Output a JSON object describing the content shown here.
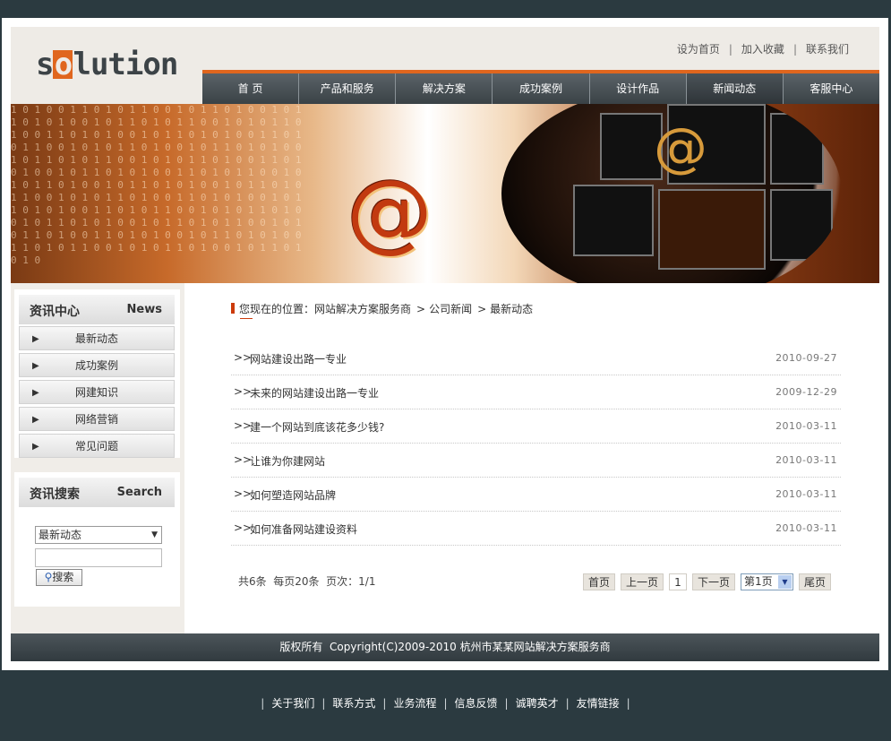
{
  "header": {
    "logo_text": "solution",
    "top_links": [
      "设为首页",
      "加入收藏",
      "联系我们"
    ],
    "nav": [
      "首 页",
      "产品和服务",
      "解决方案",
      "成功案例",
      "设计作品",
      "新闻动态",
      "客服中心"
    ],
    "active_nav": "新闻动态"
  },
  "banner": {
    "binary": "1 0 1 0 0 1 1 0 1 0 1 1 0 0 1 0 1 1 0 1 0 0 1 0 1 1 0 1 0 1 0 0 1 0 1 1 0 1 0 1 1 0 0 1 0 1 0 1 1 0 1 0 0 1 1 0 1 0 1 0 0 1 0 1 1 0 1 0 1 0 0 1 1 0 1 0 1 1 0 0 1 0 1 0 1 1 0 1 0 0 1 0 1 1 0 1 0 1 0 0 1 0 1 1 0 1 0 1 1 0 0 1 0 1 0 1 1 0 1 0 0 1 1 0 1 0 1 0 0 1 0 1 1 0 1 0 1 0 0 1 1 0 1 0 1 1 0 0 1 0 1 0 1 1 0 1 0 0 1 0 1 1 0 1 0 1 0 0 1 0 1 1 0 1 0 1 1 0 0 1 0 1 0 1 1 0 1 0 0 1 1 0 1 0 1 0 0 1 0 1 1 0 1 0 1 0 0 1 1 0 1 0 1 1 0 0 1 0 1 0 1 1 0 1 0 0 1 0 1 1 0 1 0 1 0 0 1 0 1 1 0 1 0 1 1 0 0 1 0 1 0 1 1 0 1 0 0 1 1 0 1 0 1 0 0 1 0 1 1 0 1 0 1 0 0 1 1 0 1 0 1 1 0 0 1 0 1 0 1 1 0 1 0 0 1 0 1 1 0 1 0 1 0",
    "symbol": "@"
  },
  "sidebar": {
    "news_box": {
      "title_cn": "资讯中心",
      "title_en": "News",
      "items": [
        "最新动态",
        "成功案例",
        "网建知识",
        "网络营销",
        "常见问题"
      ]
    },
    "search_box": {
      "title_cn": "资讯搜索",
      "title_en": "Search",
      "select_value": "最新动态",
      "input_value": "",
      "button_label": "搜索"
    }
  },
  "breadcrumb": {
    "prefix": "您现在的位置：",
    "items": [
      "网站解决方案服务商",
      "公司新闻",
      "最新动态"
    ]
  },
  "news_list": [
    {
      "title": "网站建设出路一专业",
      "date": "2010-09-27"
    },
    {
      "title": "未来的网站建设出路一专业",
      "date": "2009-12-29"
    },
    {
      "title": "建一个网站到底该花多少钱?",
      "date": "2010-03-11"
    },
    {
      "title": "让谁为你建网站",
      "date": "2010-03-11"
    },
    {
      "title": "如何塑造网站品牌",
      "date": "2010-03-11"
    },
    {
      "title": "如何准备网站建设资料",
      "date": "2010-03-11"
    }
  ],
  "pagination": {
    "info": "共6条  每页20条  页次：1/1",
    "first": "首页",
    "prev": "上一页",
    "current": "1",
    "next": "下一页",
    "page_select": "第1页",
    "last": "尾页"
  },
  "footer": {
    "copyright": "版权所有  Copyright(C)2009-2010 杭州市某某网站解决方案服务商"
  },
  "bottom_links": [
    "关于我们",
    "联系方式",
    "业务流程",
    "信息反馈",
    "诚聘英才",
    "友情链接"
  ],
  "colors": {
    "accent": "#e0661e",
    "nav_bg": "#3a4246",
    "page_bg": "#2b3a40",
    "breadcrumb_bar": "#cc3b0b"
  }
}
